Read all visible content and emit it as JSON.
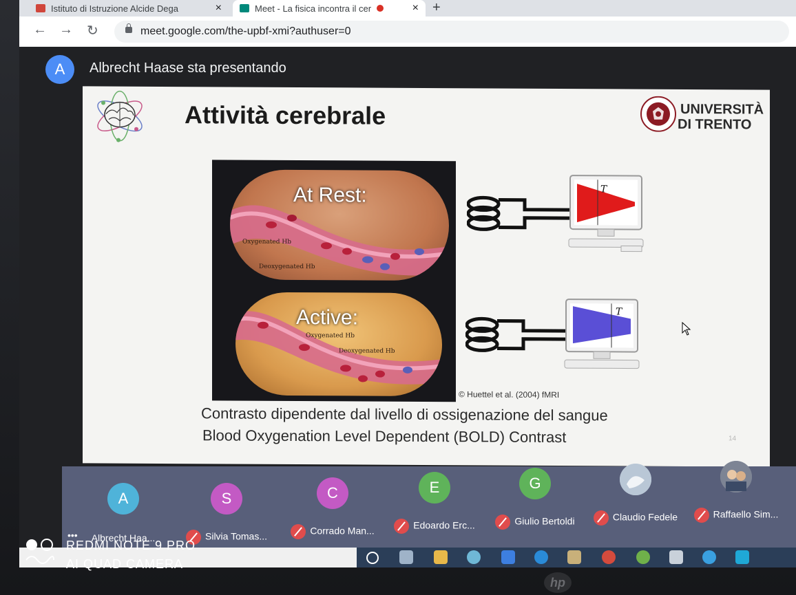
{
  "browser": {
    "tabs": [
      {
        "label": "Istituto di Istruzione Alcide Dega",
        "active": false
      },
      {
        "label": "Meet - La fisica incontra il cer",
        "active": true
      }
    ],
    "url": "meet.google.com/the-upbf-xmi?authuser=0"
  },
  "meet": {
    "presenter_initial": "A",
    "presenter_text": "Albrecht Haase sta presentando"
  },
  "slide": {
    "title": "Attività cerebrale",
    "university_line1": "UNIVERSITÀ",
    "university_line2": "DI TRENTO",
    "rest_label": "At Rest:",
    "active_label": "Active:",
    "oxy_label": "Oxygenated Hb",
    "deoxy_label": "Deoxygenated Hb",
    "rest_signal_symbol": "T",
    "active_signal_symbol": "T",
    "credit": "© Huettel et al. (2004) fMRI",
    "caption_it": "Contrasto dipendente dal livello di ossigenazione del sangue",
    "caption_en": "Blood Oxygenation Level Dependent (BOLD) Contrast",
    "slide_number": "14",
    "colors": {
      "rest_signal": "#e01b1b",
      "active_signal": "#5a4fd6"
    }
  },
  "participants": [
    {
      "initial": "A",
      "name": "Albrecht Haa...",
      "color": "#4fb3d9",
      "muted": false
    },
    {
      "initial": "S",
      "name": "Silvia Tomas...",
      "color": "#c35ac4",
      "muted": true
    },
    {
      "initial": "C",
      "name": "Corrado Man...",
      "color": "#c35ac4",
      "muted": true
    },
    {
      "initial": "E",
      "name": "Edoardo Erc...",
      "color": "#5fb35a",
      "muted": true
    },
    {
      "initial": "G",
      "name": "Giulio Bertoldi",
      "color": "#5fb35a",
      "muted": true
    },
    {
      "initial": "",
      "name": "Claudio Fedele",
      "color": "#c9d4e0",
      "muted": true
    },
    {
      "initial": "",
      "name": "Raffaello Sim...",
      "color": "#8a8f99",
      "muted": true
    }
  ],
  "watermark": {
    "line1": "REDMI NOTE 9 PRO",
    "line2": "AI QUAD CAMERA"
  },
  "laptop_brand": "hp"
}
